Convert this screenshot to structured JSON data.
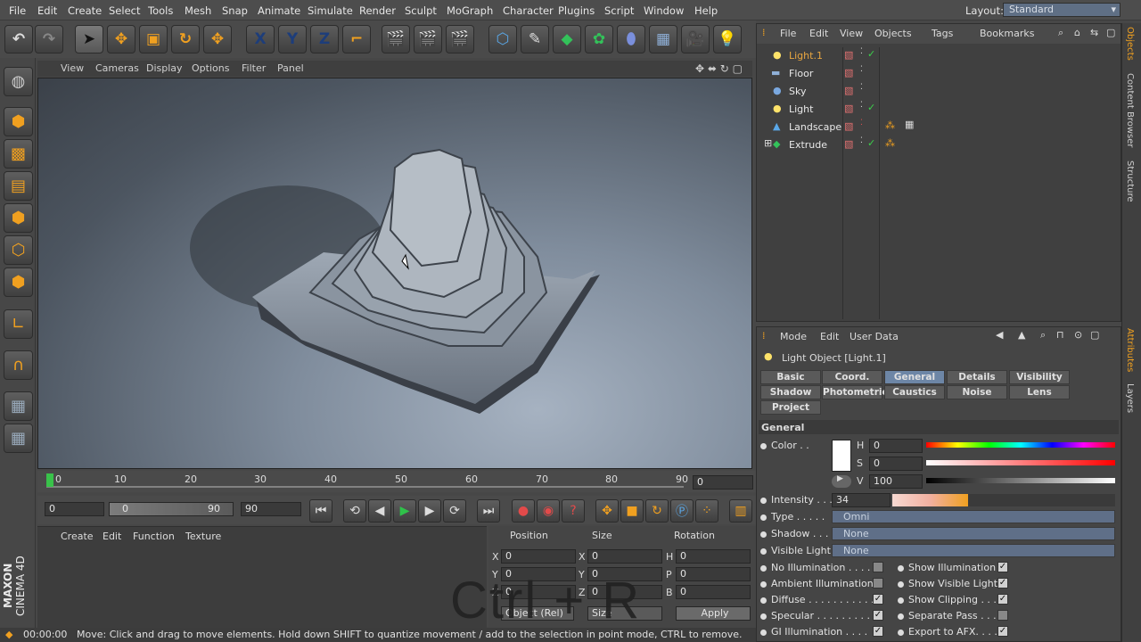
{
  "menubar": {
    "items": [
      "File",
      "Edit",
      "Create",
      "Select",
      "Tools",
      "Mesh",
      "Snap",
      "Animate",
      "Simulate",
      "Render",
      "Sculpt",
      "MoGraph",
      "Character",
      "Plugins",
      "Script",
      "Window",
      "Help"
    ],
    "layout_label": "Layout:",
    "layout_value": "Standard"
  },
  "toolbar": {
    "buttons": [
      "undo-icon",
      "redo-icon",
      "live-selection-icon",
      "move-icon",
      "scale-icon",
      "rotate-icon",
      "move-alt-icon",
      "x-axis",
      "y-axis",
      "z-axis",
      "world-coords-icon",
      "render-view-icon",
      "render-picture-queue-icon",
      "render-settings-icon",
      "cube-icon",
      "pen-spline-icon",
      "subdivision-icon",
      "cloner-icon",
      "deformer-icon",
      "floor-grid-icon",
      "camera-icon",
      "light-icon"
    ],
    "x_label": "X",
    "y_label": "Y",
    "z_label": "Z"
  },
  "viewport": {
    "menu": [
      "View",
      "Cameras",
      "Display",
      "Options",
      "Filter",
      "Panel"
    ]
  },
  "timeline": {
    "ticks": [
      "0",
      "10",
      "20",
      "30",
      "40",
      "50",
      "60",
      "70",
      "80",
      "90"
    ],
    "current_frame": "0"
  },
  "playback": {
    "start": "0",
    "slider_start": "0",
    "slider_end": "90",
    "end": "90"
  },
  "material_manager": {
    "menu": [
      "Create",
      "Edit",
      "Function",
      "Texture"
    ]
  },
  "coordinates": {
    "headers": [
      "Position",
      "Size",
      "Rotation"
    ],
    "rows": [
      {
        "a": "X",
        "a_val": "0",
        "b": "X",
        "b_val": "0",
        "c": "H",
        "c_val": "0"
      },
      {
        "a": "Y",
        "a_val": "0",
        "b": "Y",
        "b_val": "0",
        "c": "P",
        "c_val": "0"
      },
      {
        "a": "Z",
        "a_val": "0",
        "b": "Z",
        "b_val": "0",
        "c": "B",
        "c_val": "0"
      }
    ],
    "mode": "Object (Rel)",
    "size_mode": "Size",
    "apply": "Apply"
  },
  "status": {
    "time": "00:00:00",
    "message": "Move: Click and drag to move elements. Hold down SHIFT to quantize movement / add to the selection in point mode, CTRL to remove."
  },
  "object_manager": {
    "menu": [
      "File",
      "Edit",
      "View",
      "Objects",
      "Tags",
      "Bookmarks"
    ],
    "objects": [
      {
        "name": "Light.1",
        "icon": "light-icon",
        "selected": true
      },
      {
        "name": "Floor",
        "icon": "floor-icon"
      },
      {
        "name": "Sky",
        "icon": "sky-icon"
      },
      {
        "name": "Light",
        "icon": "light-icon"
      },
      {
        "name": "Landscape",
        "icon": "landscape-icon"
      },
      {
        "name": "Extrude",
        "icon": "extrude-icon"
      }
    ]
  },
  "attributes": {
    "menu": [
      "Mode",
      "Edit",
      "User Data"
    ],
    "title": "Light Object [Light.1]",
    "tabs": [
      "Basic",
      "Coord.",
      "General",
      "Details",
      "Visibility",
      "Shadow",
      "Photometric",
      "Caustics",
      "Noise",
      "Lens",
      "Project"
    ],
    "section": "General",
    "color_label": "Color . .",
    "h_label": "H",
    "h_val": "0",
    "s_label": "S",
    "s_val": "0",
    "v_label": "V",
    "v_val": "100",
    "intensity_label": "Intensity . . .",
    "intensity_val": "34",
    "type_label": "Type . . . . .",
    "type_val": "Omni",
    "shadow_label": "Shadow . . . .",
    "shadow_val": "None",
    "visible_light_label": "Visible Light",
    "visible_light_val": "None",
    "checks_left": [
      {
        "label": "No Illumination . . . . .",
        "checked": false
      },
      {
        "label": "Ambient Illumination",
        "checked": false
      },
      {
        "label": "Diffuse . . . . . . . . . . .",
        "checked": true
      },
      {
        "label": "Specular . . . . . . . . . .",
        "checked": true
      },
      {
        "label": "GI Illumination . . . .",
        "checked": true
      }
    ],
    "checks_right": [
      {
        "label": "Show Illumination",
        "checked": true
      },
      {
        "label": "Show Visible Light",
        "checked": true
      },
      {
        "label": "Show Clipping . . .",
        "checked": true
      },
      {
        "label": "Separate Pass . . .",
        "checked": false
      },
      {
        "label": "Export to AFX. . . . .",
        "checked": true
      }
    ]
  },
  "right_strip": [
    "Objects",
    "Content Browser",
    "Structure",
    "Attributes",
    "Layers"
  ],
  "brand": {
    "line1": "MAXON",
    "line2": "CINEMA 4D"
  },
  "overlay": {
    "text": "Ctrl + R"
  },
  "colors": {
    "selected_object": "#e8a640",
    "accent_tab": "#6d86a6"
  }
}
